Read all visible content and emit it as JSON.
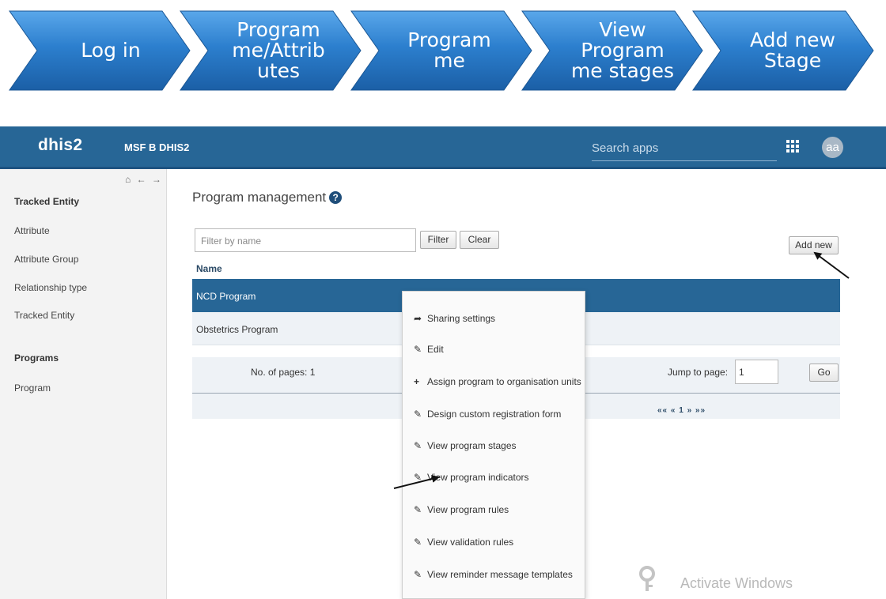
{
  "steps": [
    "Log in",
    "Program\nme/Attrib\nutes",
    "Program\nme",
    "View\nProgram\nme stages",
    "Add new\nStage"
  ],
  "header": {
    "logo": "dhis2",
    "instance": "MSF B DHIS2",
    "search_placeholder": "Search apps",
    "apps_icon": "grid-icon",
    "avatar": "aa"
  },
  "sidebar": {
    "nav_icons": "⌂ ← →",
    "tracked_entity_header": "Tracked Entity",
    "tracked_entity_items": [
      "Attribute",
      "Attribute Group",
      "Relationship type",
      "Tracked Entity"
    ],
    "programs_header": "Programs",
    "programs_items": [
      "Program"
    ]
  },
  "main": {
    "title": "Program management",
    "filter_placeholder": "Filter by name",
    "filter_button": "Filter",
    "clear_button": "Clear",
    "add_new_button": "Add new",
    "column_header": "Name",
    "rows": [
      "NCD Program",
      "Obstetrics Program"
    ],
    "pager": {
      "pages_label": "No. of pages: 1",
      "jump_label": "Jump to page:",
      "jump_value": "1",
      "go_button": "Go",
      "nav": "««  «  1  »  »»"
    }
  },
  "context_menu": [
    {
      "icon": "share-icon",
      "label": "Sharing settings"
    },
    {
      "icon": "edit-icon",
      "label": "Edit"
    },
    {
      "icon": "plus-icon",
      "label": "Assign program to organisation units"
    },
    {
      "icon": "edit-icon",
      "label": "Design custom registration form"
    },
    {
      "icon": "edit-icon",
      "label": "View program stages"
    },
    {
      "icon": "edit-icon",
      "label": "View program indicators"
    },
    {
      "icon": "edit-icon",
      "label": "View program rules"
    },
    {
      "icon": "edit-icon",
      "label": "View validation rules"
    },
    {
      "icon": "edit-icon",
      "label": "View reminder message templates"
    }
  ],
  "watermark": "Activate Windows",
  "colors": {
    "chevron": "#2c7fce",
    "header": "#276696",
    "selected_row": "#276696"
  }
}
